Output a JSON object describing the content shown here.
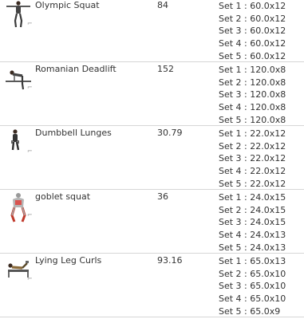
{
  "colors": {
    "text": "#333333",
    "divider": "#d6d6d6",
    "background": "#ffffff"
  },
  "exercises": [
    {
      "name": "Olympic Squat",
      "volume": "84",
      "icon": "olympic-squat-figure",
      "sets": [
        "Set 1 : 60.0x12",
        "Set 2 : 60.0x12",
        "Set 3 : 60.0x12",
        "Set 4 : 60.0x12",
        "Set 5 : 60.0x12"
      ]
    },
    {
      "name": "Romanian Deadlift",
      "volume": "152",
      "icon": "romanian-deadlift-figure",
      "sets": [
        "Set 1 : 120.0x8",
        "Set 2 : 120.0x8",
        "Set 3 : 120.0x8",
        "Set 4 : 120.0x8",
        "Set 5 : 120.0x8"
      ]
    },
    {
      "name": "Dumbbell Lunges",
      "volume": "30.79",
      "icon": "dumbbell-lunges-figure",
      "sets": [
        "Set 1 : 22.0x12",
        "Set 2 : 22.0x12",
        "Set 3 : 22.0x12",
        "Set 4 : 22.0x12",
        "Set 5 : 22.0x12"
      ]
    },
    {
      "name": "goblet squat",
      "volume": "36",
      "icon": "goblet-squat-figure",
      "sets": [
        "Set 1 : 24.0x15",
        "Set 2 : 24.0x15",
        "Set 3 : 24.0x15",
        "Set 4 : 24.0x13",
        "Set 5 : 24.0x13"
      ]
    },
    {
      "name": "Lying Leg Curls",
      "volume": "93.16",
      "icon": "lying-leg-curls-figure",
      "sets": [
        "Set 1 : 65.0x13",
        "Set 2 : 65.0x10",
        "Set 3 : 65.0x10",
        "Set 4 : 65.0x10",
        "Set 5 : 65.0x9"
      ]
    }
  ]
}
